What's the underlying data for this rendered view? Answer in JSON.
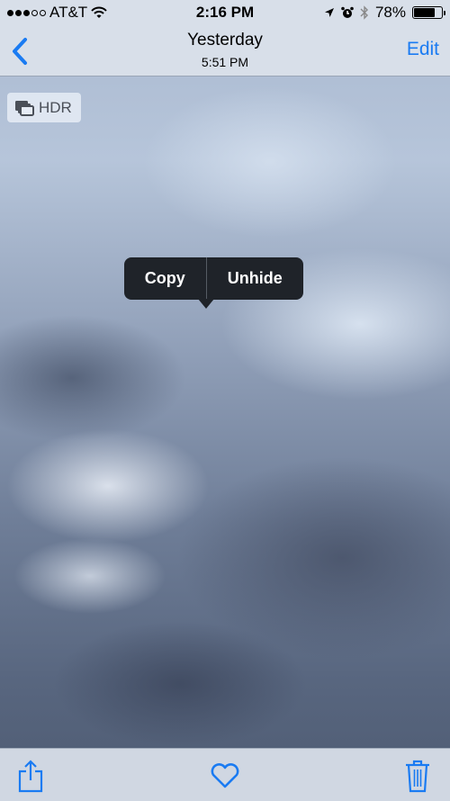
{
  "status_bar": {
    "signal_filled": 3,
    "signal_total": 5,
    "carrier": "AT&T",
    "time": "2:16 PM",
    "battery_percent_label": "78%",
    "battery_level": 0.78,
    "icons": [
      "wifi-icon",
      "location-arrow-icon",
      "alarm-icon",
      "bluetooth-icon",
      "battery-icon"
    ]
  },
  "nav": {
    "back_icon": "chevron-left-icon",
    "title": "Yesterday",
    "subtitle": "5:51 PM",
    "edit_label": "Edit"
  },
  "photo": {
    "badge_label": "HDR",
    "badge_icon": "hdr-layers-icon"
  },
  "context_menu": {
    "items": [
      {
        "label": "Copy"
      },
      {
        "label": "Unhide"
      }
    ]
  },
  "toolbar": {
    "icons": [
      "share-icon",
      "heart-icon",
      "trash-icon"
    ]
  },
  "colors": {
    "accent": "#1a7bf2",
    "bar_background": "#d8dfe9",
    "menu_background": "#1f2329"
  }
}
